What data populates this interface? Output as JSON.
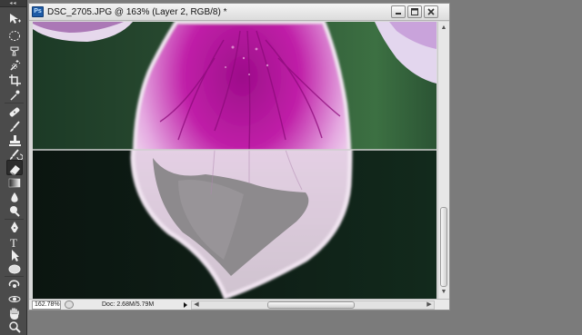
{
  "toolbar": {
    "grip": "◂◂",
    "tools": [
      {
        "name": "move-tool",
        "icon": "move-icon"
      },
      {
        "name": "marquee-tool",
        "icon": "elliptical-marquee-icon"
      },
      {
        "name": "lasso-tool",
        "icon": "lasso-icon"
      },
      {
        "name": "quick-selection-tool",
        "icon": "magic-wand-icon"
      },
      {
        "name": "crop-tool",
        "icon": "crop-icon"
      },
      {
        "name": "eyedropper-tool",
        "icon": "eyedropper-icon"
      },
      {
        "name": "healing-brush-tool",
        "icon": "bandage-icon"
      },
      {
        "name": "brush-tool",
        "icon": "brush-icon"
      },
      {
        "name": "clone-stamp-tool",
        "icon": "stamp-icon"
      },
      {
        "name": "history-brush-tool",
        "icon": "history-brush-icon"
      },
      {
        "name": "eraser-tool",
        "icon": "eraser-icon"
      },
      {
        "name": "gradient-tool",
        "icon": "gradient-icon"
      },
      {
        "name": "blur-tool",
        "icon": "drop-icon"
      },
      {
        "name": "dodge-tool",
        "icon": "dodge-icon"
      },
      {
        "name": "pen-tool",
        "icon": "pen-icon"
      },
      {
        "name": "type-tool",
        "icon": "type-icon"
      },
      {
        "name": "path-selection-tool",
        "icon": "arrow-icon"
      },
      {
        "name": "shape-tool",
        "icon": "ellipse-icon"
      },
      {
        "name": "3d-rotate-tool",
        "icon": "3d-rotate-icon"
      },
      {
        "name": "3d-orbit-tool",
        "icon": "3d-orbit-icon"
      },
      {
        "name": "hand-tool",
        "icon": "hand-icon"
      },
      {
        "name": "zoom-tool",
        "icon": "zoom-icon"
      }
    ],
    "active_tool": "eraser-tool"
  },
  "document": {
    "title": "DSC_2705.JPG @ 163% (Layer 2, RGB/8) *",
    "app_icon_label": "Ps",
    "zoom": "162.78%",
    "doc_size": "Doc: 2.68M/5.79M"
  },
  "colors": {
    "workspace": "#7b7b7b",
    "toolbar": "#4b4b4b",
    "petal_magenta": "#b0129a",
    "petal_pale": "#efd9ee",
    "background_green": "#2f5a38",
    "masked_dark": "#0f1c16"
  }
}
